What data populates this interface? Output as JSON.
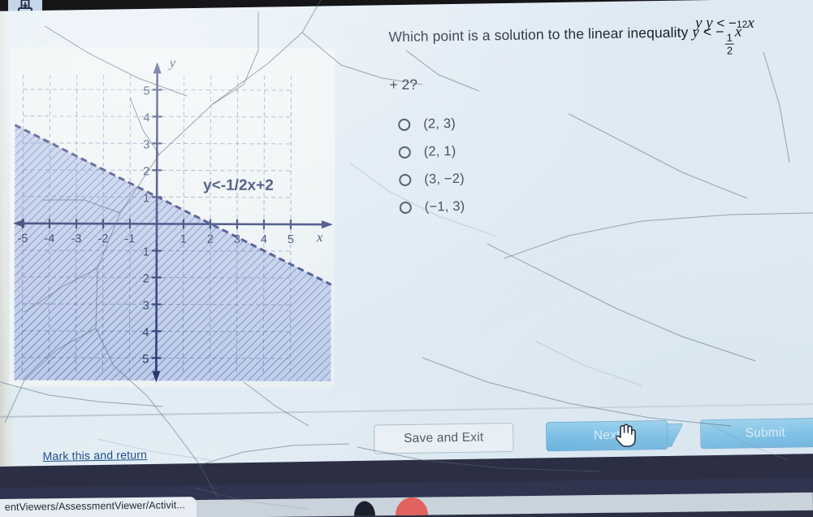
{
  "window": {
    "top_left_icon": "save-disk-icon",
    "top_formula_echo": "y y < − 1/2 x"
  },
  "question": {
    "text_before": "Which point is a solution to the linear inequality ",
    "var_y": "y",
    "operator": "<",
    "minus": "−",
    "fraction_numerator": "1",
    "fraction_denominator": "2",
    "var_x": "x",
    "line2": "+ 2?"
  },
  "options": [
    {
      "id": "opt-a",
      "label": "(2, 3)",
      "selected": false
    },
    {
      "id": "opt-b",
      "label": "(2, 1)",
      "selected": false
    },
    {
      "id": "opt-c",
      "label": "(3, −2)",
      "selected": false
    },
    {
      "id": "opt-d",
      "label": "(−1, 3)",
      "selected": false
    }
  ],
  "graph": {
    "inequality_label": "y<-1/2x+2",
    "x_axis_label": "x",
    "y_axis_label": "y",
    "x_ticks": [
      "-5",
      "-4",
      "-3",
      "-2",
      "-1",
      "1",
      "2",
      "3",
      "4",
      "5"
    ],
    "y_ticks_positive": [
      "5",
      "4",
      "3",
      "2",
      "1"
    ],
    "y_ticks_negative": [
      "1",
      "2",
      "3",
      "4",
      "5"
    ],
    "shading": "below-line",
    "line_style": "dashed",
    "shade_color": "#93a9d6"
  },
  "chart_data": {
    "type": "line",
    "title": "",
    "xlabel": "x",
    "ylabel": "y",
    "xlim": [
      -5,
      5
    ],
    "ylim": [
      -5,
      5
    ],
    "grid": true,
    "annotations": [
      "y<-1/2x+2"
    ],
    "series": [
      {
        "name": "y = -1/2x + 2",
        "style": "dashed",
        "slope": -0.5,
        "intercept": 2,
        "x": [
          -5,
          5
        ],
        "values": [
          4.5,
          -0.5
        ]
      }
    ],
    "region": {
      "name": "solution set",
      "inequality": "y < -1/2x + 2",
      "fill": "below",
      "hatch": "diagonal"
    }
  },
  "footer": {
    "mark_and_return": "Mark this and return",
    "save_exit_label": "Save and Exit",
    "next_label": "Next",
    "submit_label": "Submit"
  },
  "taskbar": {
    "task_label": "entViewers/AssessmentViewer/Activit..."
  },
  "colors": {
    "page_background": "#dfe9f1",
    "primary_button": "#3ea5dd",
    "text": "#121a28",
    "link": "#1d4e87",
    "graph_ink": "#2a3a6e",
    "taskbar": "#31344f"
  }
}
